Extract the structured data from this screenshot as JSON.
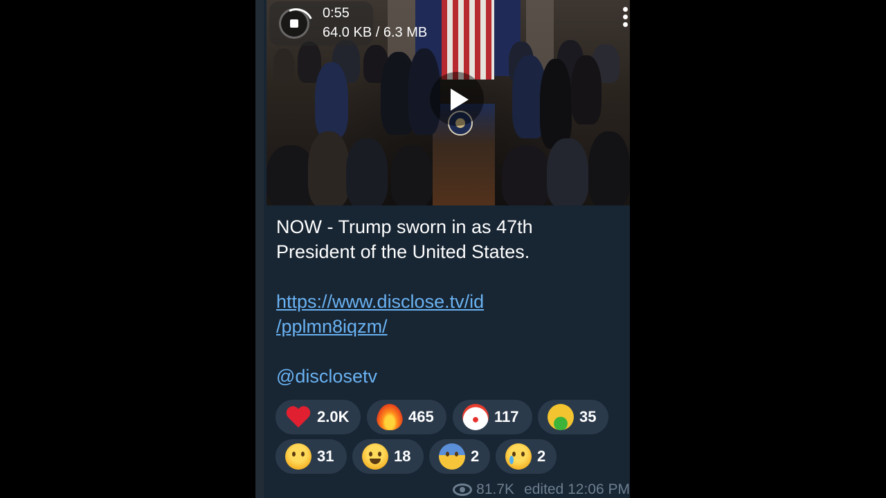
{
  "video": {
    "duration": "0:55",
    "download_progress": "64.0 KB / 6.3 MB",
    "icons": {
      "download": "stop-download-icon",
      "play": "play-icon",
      "menu": "more-vertical-icon"
    }
  },
  "message": {
    "caption_line1": "NOW - Trump sworn in as 47th",
    "caption_line2": "President of the United States.",
    "link_line1": "https://www.disclose.tv/id",
    "link_line2": "/pplmn8iqzm/",
    "mention": "@disclosetv"
  },
  "reactions": [
    {
      "emoji": "heart",
      "count": "2.0K"
    },
    {
      "emoji": "fire",
      "count": "465"
    },
    {
      "emoji": "clown",
      "count": "117"
    },
    {
      "emoji": "vomiting",
      "count": "35"
    },
    {
      "emoji": "thinking",
      "count": "31"
    },
    {
      "emoji": "grinning",
      "count": "18"
    },
    {
      "emoji": "screaming",
      "count": "2"
    },
    {
      "emoji": "crying",
      "count": "2"
    }
  ],
  "footer": {
    "views": "81.7K",
    "edited": "edited 12:06 PM",
    "icon": "eye-icon"
  },
  "colors": {
    "bubble": "#182533",
    "link": "#6ab3f3",
    "reaction_bg": "#2b3a4b",
    "meta": "#6d7f8f"
  }
}
